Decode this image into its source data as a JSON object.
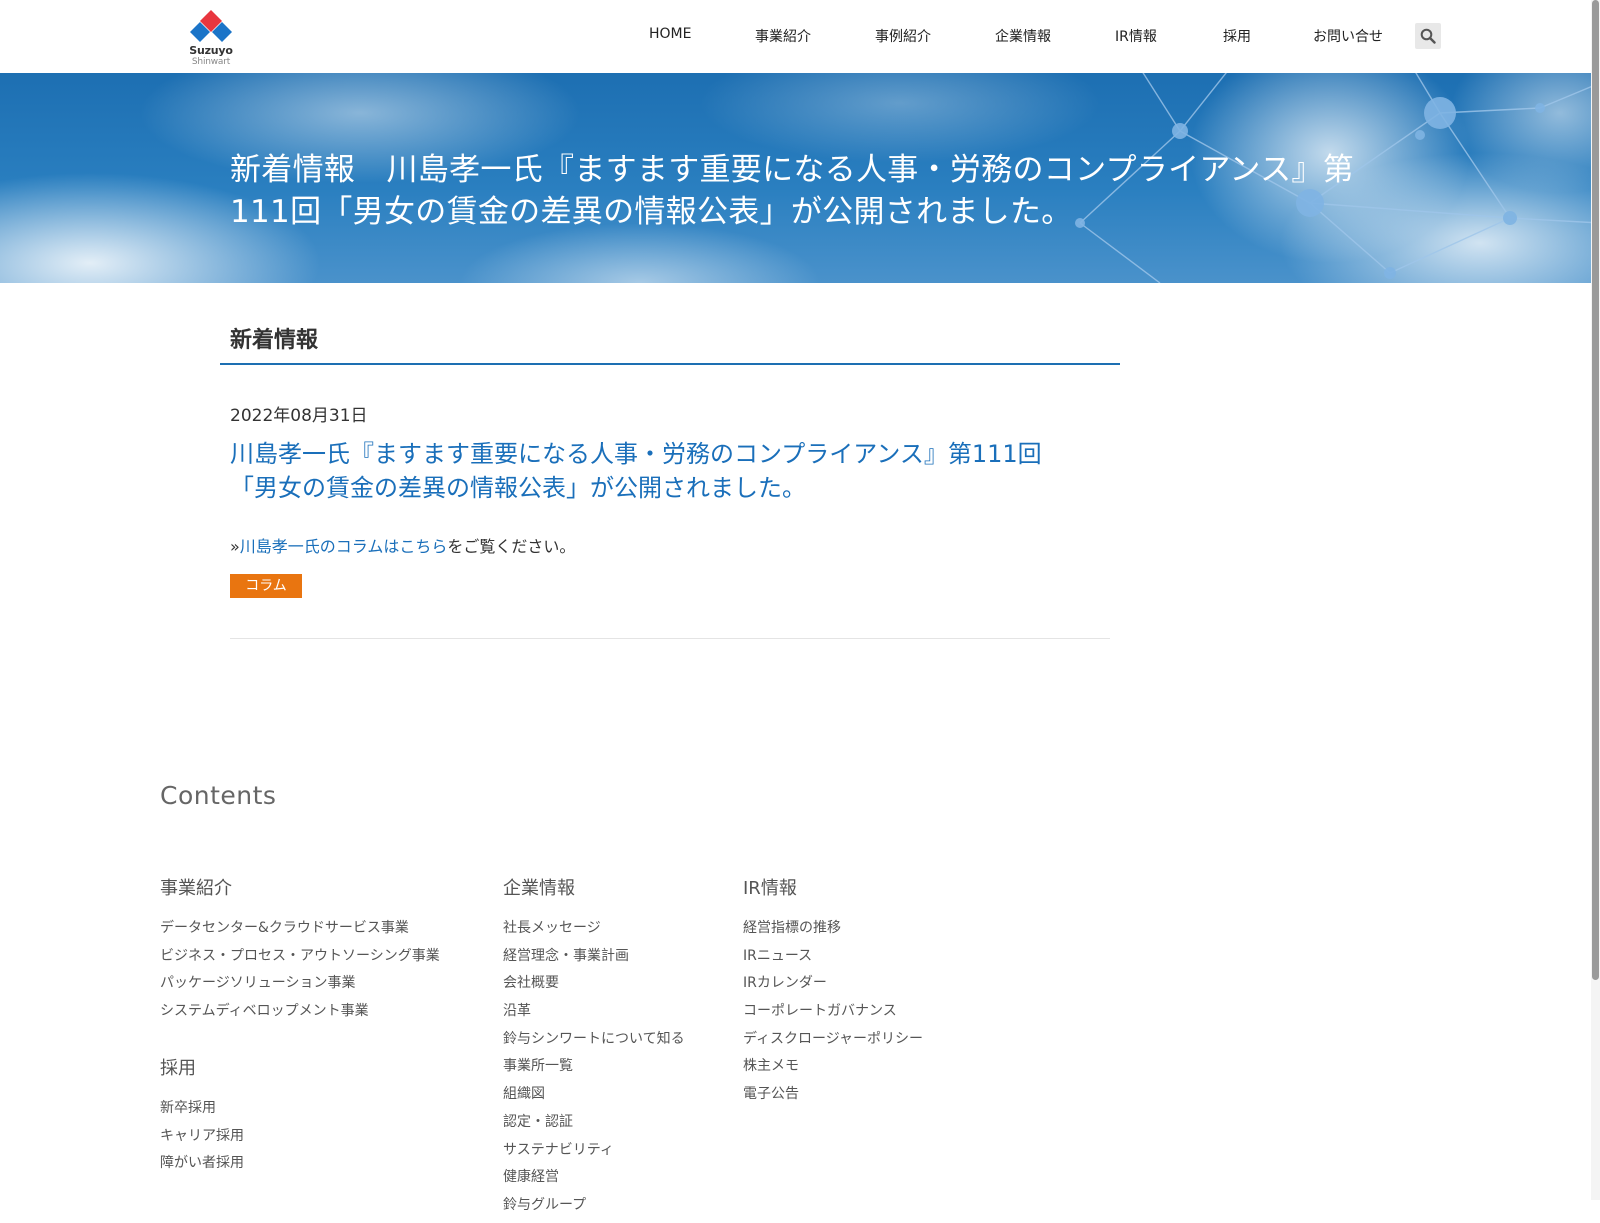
{
  "header": {
    "logo": {
      "line1": "Suzuyo",
      "line2": "Shinwart"
    },
    "nav": [
      "HOME",
      "事業紹介",
      "事例紹介",
      "企業情報",
      "IR情報",
      "採用",
      "お問い合せ"
    ],
    "search_icon": "search-icon"
  },
  "hero": {
    "title_line1": "新着情報　川島孝一氏『ますます重要になる人事・労務のコンプライアンス』第",
    "title_line2": "111回「男女の賃金の差異の情報公表」が公開されました。"
  },
  "main": {
    "section_title": "新着情報",
    "date": "2022年08月31日",
    "article_title_line1": "川島孝一氏『ますます重要になる人事・労務のコンプライアンス』第111回",
    "article_title_line2": "「男女の賃金の差異の情報公表」が公開されました。",
    "body_prefix": "»",
    "body_link": "川島孝一氏のコラムはこちら",
    "body_suffix": "をご覧ください。",
    "tag": "コラム"
  },
  "footer": {
    "heading": "Contents",
    "business": {
      "title": "事業紹介",
      "links": [
        "データセンター&クラウドサービス事業",
        "ビジネス・プロセス・アウトソーシング事業",
        "パッケージソリューション事業",
        "システムディベロップメント事業"
      ]
    },
    "recruit": {
      "title": "採用",
      "links": [
        "新卒採用",
        "キャリア採用",
        "障がい者採用"
      ]
    },
    "company": {
      "title": "企業情報",
      "links": [
        "社長メッセージ",
        "経営理念・事業計画",
        "会社概要",
        "沿革",
        "鈴与シンワートについて知る",
        "事業所一覧",
        "組織図",
        "認定・認証",
        "サステナビリティ",
        "健康経営",
        "鈴与グループ"
      ]
    },
    "ir": {
      "title": "IR情報",
      "links": [
        "経営指標の推移",
        "IRニュース",
        "IRカレンダー",
        "コーポレートガバナンス",
        "ディスクロージャーポリシー",
        "株主メモ",
        "電子公告"
      ]
    }
  },
  "colors": {
    "brand_blue": "#1d6fb2",
    "link_blue": "#1a6fba",
    "tag_orange": "#e97510",
    "logo_red": "#e8363f",
    "logo_blue": "#1b74c8"
  }
}
